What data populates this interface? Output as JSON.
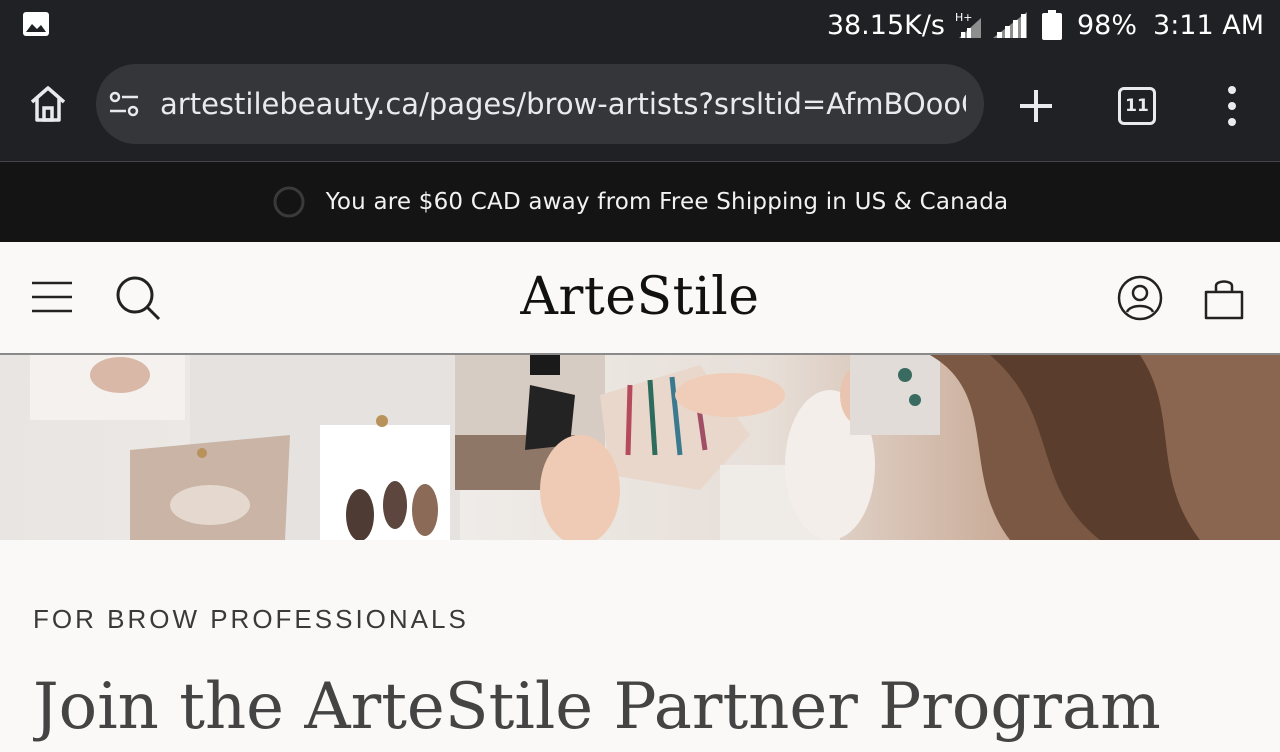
{
  "status_bar": {
    "gallery_icon": "image-icon",
    "net_speed": "38.15K/s",
    "network_type": "H+",
    "battery_percent": "98%",
    "time": "3:11 AM"
  },
  "browser": {
    "url": "artestilebeauty.ca/pages/brow-artists?srsltid=AfmBOooC",
    "tab_count": "11",
    "icons": {
      "home": "home-icon",
      "site_info": "site-settings-icon",
      "new_tab": "plus-icon",
      "tabs": "tab-switcher-icon",
      "menu": "more-vert-icon"
    }
  },
  "announcement": {
    "text": "You are $60 CAD away from Free Shipping in US & Canada",
    "progress": 0
  },
  "site_header": {
    "logo": "ArteStile",
    "icons": {
      "menu": "hamburger-icon",
      "search": "search-icon",
      "account": "account-icon",
      "cart": "bag-icon"
    }
  },
  "content": {
    "eyebrow": "FOR BROW PROFESSIONALS",
    "title": "Join the ArteStile Partner Program"
  },
  "colors": {
    "chrome_bg": "#202124",
    "urlbar_bg": "#35363a",
    "announce_bg": "#141414",
    "page_bg": "#faf9f7"
  }
}
